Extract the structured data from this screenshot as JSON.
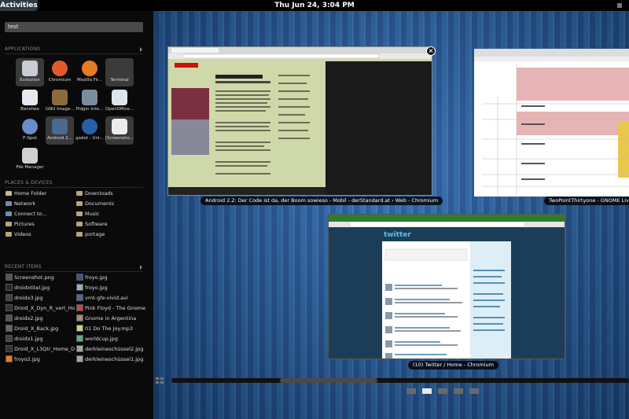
{
  "topbar": {
    "activities_label": "Activities",
    "clock": "Thu Jun 24,  3:04 PM"
  },
  "search": {
    "value": "test"
  },
  "sections": {
    "applications": "APPLICATIONS",
    "places": "PLACES & DEVICES",
    "recent": "RECENT ITEMS"
  },
  "apps": [
    {
      "label": "Evolution"
    },
    {
      "label": "Chromium"
    },
    {
      "label": "Mozilla Fir..."
    },
    {
      "label": "Terminal"
    },
    {
      "label": "Banshee"
    },
    {
      "label": "GNU Image..."
    },
    {
      "label": "Pidgin Inte..."
    },
    {
      "label": "OpenOffice..."
    },
    {
      "label": "F-Spot"
    },
    {
      "label": "Android 2..."
    },
    {
      "label": "gadot - Uni..."
    },
    {
      "label": "[Screensho..."
    },
    {
      "label": "File Manager"
    }
  ],
  "places": [
    {
      "label": "Home Folder"
    },
    {
      "label": "Downloads"
    },
    {
      "label": "Network"
    },
    {
      "label": "Documents"
    },
    {
      "label": "Connect to..."
    },
    {
      "label": "Music"
    },
    {
      "label": "Pictures"
    },
    {
      "label": "Software"
    },
    {
      "label": "Videos"
    },
    {
      "label": "portage"
    }
  ],
  "recent": [
    {
      "label": "Screenshot.png"
    },
    {
      "label": "froyo.jpg"
    },
    {
      "label": "droidxtitel.jpg"
    },
    {
      "label": "froyo.jpg"
    },
    {
      "label": "droidx3.jpg"
    },
    {
      "label": "vmt-gfe-vivid.avi"
    },
    {
      "label": "Droid_X_Dyn_R_vert_Hom..."
    },
    {
      "label": "Pink Floyd - The Gnome"
    },
    {
      "label": "droidx2.jpg"
    },
    {
      "label": "Gnome in Argentina"
    },
    {
      "label": "Droid_X_Back.jpg"
    },
    {
      "label": "01 Do The Joy.mp3"
    },
    {
      "label": "droidx1.jpg"
    },
    {
      "label": "worldcup.jpg"
    },
    {
      "label": "Droid_X_L3Qtr_Home_Def..."
    },
    {
      "label": "derkleineschüssel2.jpg"
    },
    {
      "label": "froyo2.jpg"
    },
    {
      "label": "derkleineschüssel1.jpg"
    }
  ],
  "windows": {
    "w1": {
      "caption": "Android 2.2: Der Code ist da, der Boom sowieso - Mobil - derStandard.at › Web - Chromium",
      "close": "×"
    },
    "w2": {
      "caption": "TwoPointThirtyone - GNOME Live! - Chromium"
    },
    "w3": {
      "caption": "(10) Twitter / Home - Chromium"
    }
  },
  "workspaces": {
    "count": 5,
    "active": 1
  }
}
